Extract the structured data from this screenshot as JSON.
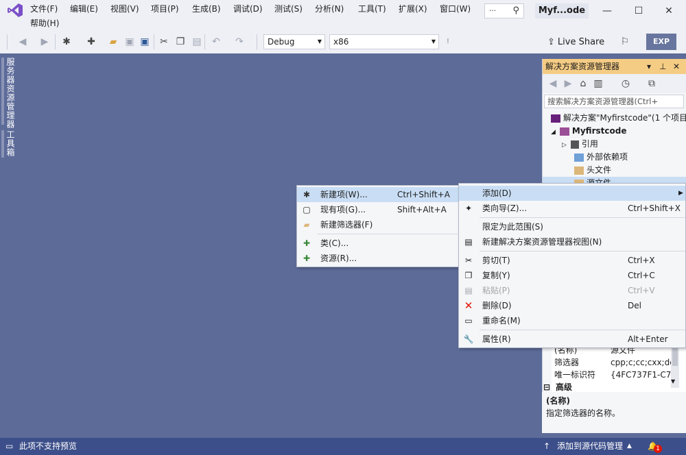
{
  "menu": {
    "items": [
      "文件(F)",
      "编辑(E)",
      "视图(V)",
      "项目(P)",
      "生成(B)",
      "调试(D)",
      "测试(S)",
      "分析(N)",
      "工具(T)",
      "扩展(X)",
      "窗口(W)",
      "帮助(H)"
    ],
    "solution_badge": "Myf...ode"
  },
  "toolbar": {
    "config": "Debug",
    "platform": "x86",
    "live_share": "Live Share",
    "exp": "EXP"
  },
  "left_tabs": [
    "服务器资源管理器",
    "工具箱"
  ],
  "solution_explorer": {
    "title": "解决方案资源管理器",
    "search_placeholder": "搜索解决方案资源管理器(Ctrl+",
    "tree": [
      {
        "label": "解决方案\"Myfirstcode\"(1 个项目"
      },
      {
        "label": "Myfirstcode"
      },
      {
        "label": "引用"
      },
      {
        "label": "外部依赖项"
      },
      {
        "label": "头文件"
      },
      {
        "label": "源文件"
      }
    ]
  },
  "properties": {
    "rows": [
      {
        "key": "(名称)",
        "value": "源文件"
      },
      {
        "key": "筛选器",
        "value": "cpp;c;cc;cxx;de"
      },
      {
        "key": "唯一标识符",
        "value": "{4FC737F1-C7A"
      }
    ],
    "section": "高级",
    "desc_title": "(名称)",
    "desc_text": "指定筛选器的名称。"
  },
  "submenu": {
    "items": [
      {
        "label": "新建项(W)...",
        "shortcut": "Ctrl+Shift+A",
        "icon": "new-item-icon"
      },
      {
        "label": "现有项(G)...",
        "shortcut": "Shift+Alt+A",
        "icon": "existing-item-icon"
      },
      {
        "label": "新建筛选器(F)",
        "shortcut": "",
        "icon": "new-filter-icon"
      },
      {
        "label": "类(C)...",
        "shortcut": "",
        "icon": "class-icon"
      },
      {
        "label": "资源(R)...",
        "shortcut": "",
        "icon": "resource-icon"
      }
    ]
  },
  "context_menu": {
    "items": [
      {
        "label": "添加(D)",
        "shortcut": ""
      },
      {
        "label": "类向导(Z)...",
        "shortcut": "Ctrl+Shift+X"
      },
      {
        "label": "限定为此范围(S)",
        "shortcut": ""
      },
      {
        "label": "新建解决方案资源管理器视图(N)",
        "shortcut": ""
      },
      {
        "label": "剪切(T)",
        "shortcut": "Ctrl+X"
      },
      {
        "label": "复制(Y)",
        "shortcut": "Ctrl+C"
      },
      {
        "label": "粘贴(P)",
        "shortcut": "Ctrl+V"
      },
      {
        "label": "删除(D)",
        "shortcut": "Del"
      },
      {
        "label": "重命名(M)",
        "shortcut": ""
      },
      {
        "label": "属性(R)",
        "shortcut": "Alt+Enter"
      }
    ]
  },
  "status": {
    "left": "此项不支持预览",
    "source_control": "添加到源代码管理",
    "notification_count": "1"
  },
  "colors": {
    "workspace": "#5d6b99",
    "menu_highlight": "#c9def5",
    "statusbar": "#3d4f8a",
    "panel_header": "#f5cc84",
    "delete_red": "#e51400"
  }
}
